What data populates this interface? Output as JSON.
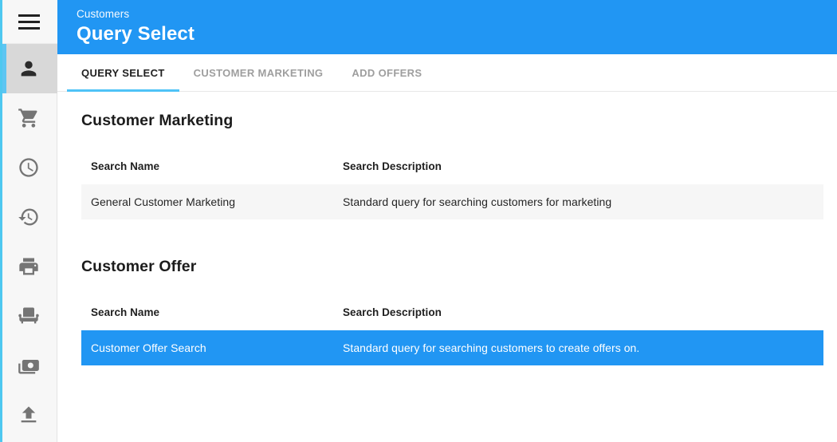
{
  "theme": {
    "primary": "#2196f3",
    "accent_underline": "#4fc3f7",
    "edge_strip": "#4ec8f0",
    "active_nav_bg": "#d8d8d8",
    "row_alt_bg": "#f6f6f6",
    "selected_row_bg": "#2196f3"
  },
  "sidebar": {
    "menu_toggle": {
      "name": "hamburger-menu-button",
      "icon": "hamburger-icon"
    },
    "items": [
      {
        "icon": "person-icon",
        "label": "Customers",
        "active": true
      },
      {
        "icon": "shopping-cart-icon",
        "label": "Orders",
        "active": false
      },
      {
        "icon": "clock-icon",
        "label": "Schedule",
        "active": false
      },
      {
        "icon": "history-icon",
        "label": "History",
        "active": false
      },
      {
        "icon": "printer-icon",
        "label": "Print",
        "active": false
      },
      {
        "icon": "seat-icon",
        "label": "Seating",
        "active": false
      },
      {
        "icon": "money-icon",
        "label": "Payments",
        "active": false
      },
      {
        "icon": "upload-icon",
        "label": "Upload",
        "active": false
      }
    ]
  },
  "header": {
    "breadcrumb": "Customers",
    "title": "Query Select"
  },
  "tabs": [
    {
      "label": "QUERY SELECT",
      "active": true
    },
    {
      "label": "CUSTOMER MARKETING",
      "active": false
    },
    {
      "label": "ADD OFFERS",
      "active": false
    }
  ],
  "sections": [
    {
      "title": "Customer Marketing",
      "columns": [
        "Search Name",
        "Search Description"
      ],
      "rows": [
        {
          "name": "General Customer Marketing",
          "description": "Standard query for searching customers for marketing",
          "selected": false
        }
      ]
    },
    {
      "title": "Customer Offer",
      "columns": [
        "Search Name",
        "Search Description"
      ],
      "rows": [
        {
          "name": "Customer Offer Search",
          "description": "Standard query for searching customers to create offers on.",
          "selected": true
        }
      ]
    }
  ]
}
